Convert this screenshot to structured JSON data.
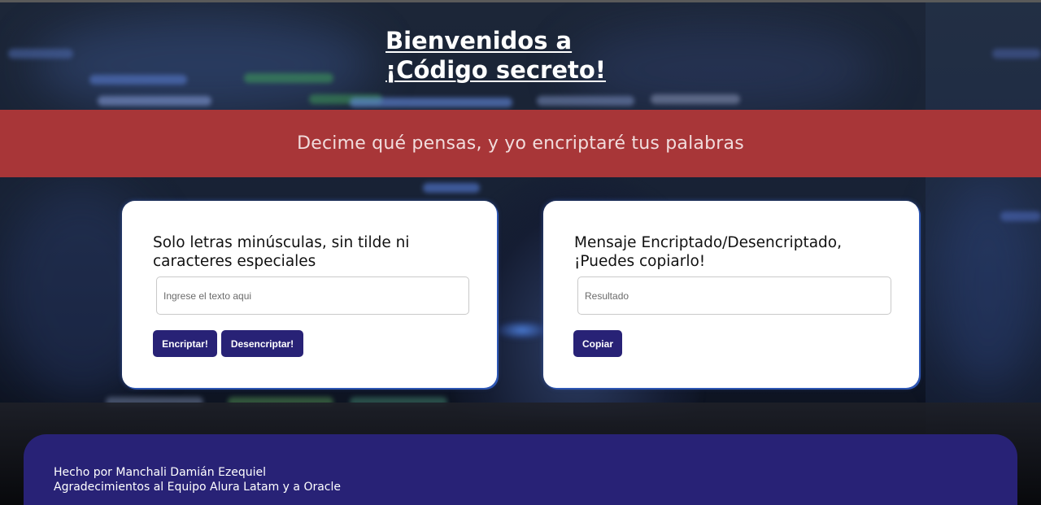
{
  "header": {
    "title_line1": "Bienvenidos a",
    "title_line2": "¡Código secreto!"
  },
  "banner": {
    "text": "Decime qué pensas, y yo encriptaré tus palabras"
  },
  "encrypt_card": {
    "heading_line1": "Solo letras minúsculas, sin tilde ni",
    "heading_line2": "caracteres especiales",
    "input_placeholder": "Ingrese el texto aqui",
    "input_value": "",
    "encrypt_label": "Encriptar!",
    "decrypt_label": "Desencriptar!"
  },
  "result_card": {
    "heading_line1": "Mensaje Encriptado/Desencriptado,",
    "heading_line2": "¡Puedes copiarlo!",
    "output_placeholder": "Resultado",
    "output_value": "",
    "copy_label": "Copiar"
  },
  "footer": {
    "credit": "Hecho por Manchali Damián Ezequiel",
    "thanks": "Agradecimientos al Equipo Alura Latam y a Oracle"
  },
  "colors": {
    "banner": "#a83638",
    "button": "#282276",
    "footer": "#282276",
    "card": "#ffffff"
  }
}
